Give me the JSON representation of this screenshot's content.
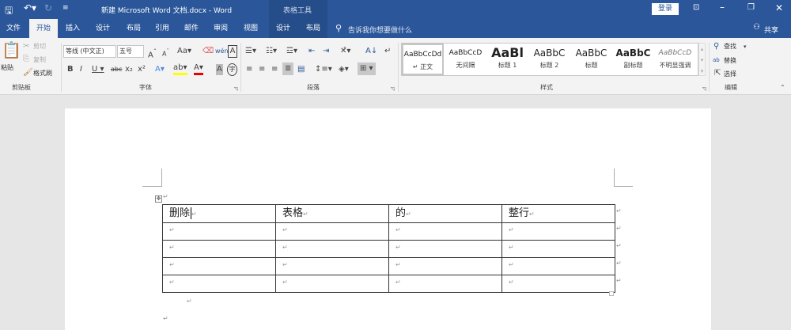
{
  "title_bar": {
    "title": "新建 Microsoft Word 文档.docx  -  Word",
    "context_tab_group": "表格工具",
    "login": "登录"
  },
  "tabs": [
    {
      "label": "文件"
    },
    {
      "label": "开始",
      "active": true
    },
    {
      "label": "插入"
    },
    {
      "label": "设计"
    },
    {
      "label": "布局"
    },
    {
      "label": "引用"
    },
    {
      "label": "邮件"
    },
    {
      "label": "审阅"
    },
    {
      "label": "视图"
    },
    {
      "label": "设计"
    },
    {
      "label": "布局"
    }
  ],
  "tell_me": "告诉我你想要做什么",
  "share": "共享",
  "clipboard": {
    "paste": "粘贴",
    "cut": "剪切",
    "copy": "复制",
    "format_painter": "格式刷",
    "label": "剪贴板"
  },
  "font": {
    "name": "等线 (中文正)",
    "size": "五号",
    "label": "字体"
  },
  "paragraph": {
    "label": "段落"
  },
  "styles": {
    "label": "样式",
    "items": [
      {
        "preview": "AaBbCcDd",
        "name": "↵ 正文"
      },
      {
        "preview": "AaBbCcD",
        "name": "无间隔"
      },
      {
        "preview": "AaBl",
        "name": "标题 1"
      },
      {
        "preview": "AaBbC",
        "name": "标题 2"
      },
      {
        "preview": "AaBbC",
        "name": "标题"
      },
      {
        "preview": "AaBbC",
        "name": "副标题"
      },
      {
        "preview": "AaBbCcD",
        "name": "不明显强调"
      }
    ]
  },
  "editing": {
    "find": "查找",
    "replace": "替换",
    "select": "选择",
    "label": "编辑"
  },
  "document": {
    "table": [
      [
        "删除",
        "表格",
        "的",
        "整行"
      ],
      [
        "",
        "",
        "",
        ""
      ],
      [
        "",
        "",
        "",
        ""
      ],
      [
        "",
        "",
        "",
        ""
      ],
      [
        "",
        "",
        "",
        ""
      ]
    ],
    "para_mark": "↵"
  },
  "colors": {
    "brand": "#2b579a"
  }
}
